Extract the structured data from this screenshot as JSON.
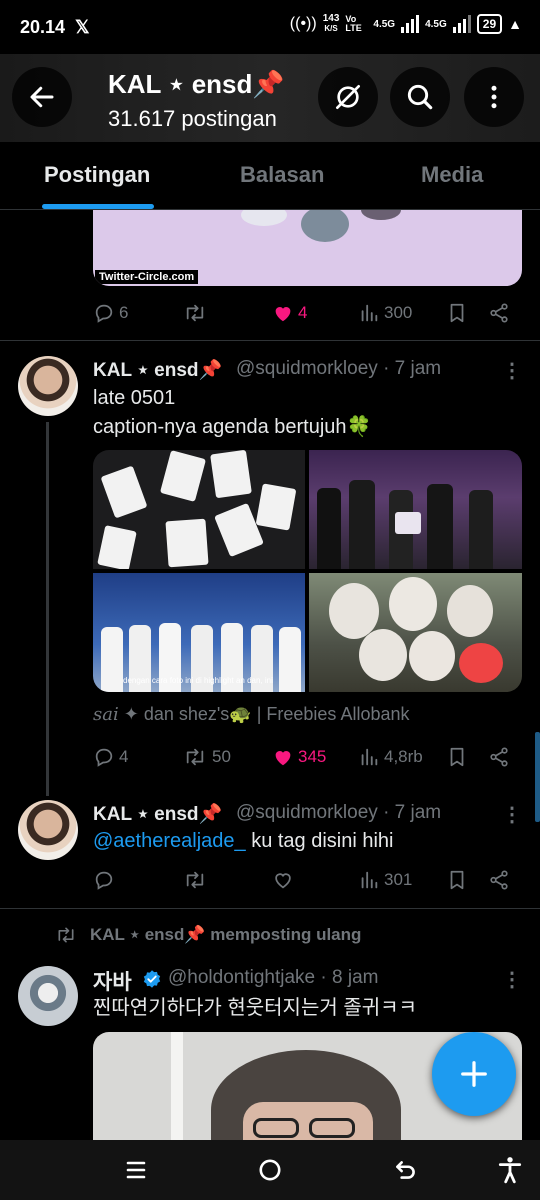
{
  "status_bar": {
    "time": "20.14",
    "app_icon": "x-logo-icon",
    "speed_value": "143",
    "speed_unit": "K/S",
    "volte": "Vo LTE",
    "net1": "4.5G",
    "net2": "4.5G",
    "battery": "29"
  },
  "header": {
    "title": "KAL ⋆ ensd📌",
    "post_count": "31.617 postingan",
    "back_icon": "arrow-left-icon",
    "circle_icon": "circle-slash-icon",
    "search_icon": "search-icon",
    "more_icon": "more-vertical-icon"
  },
  "tabs": [
    {
      "label": "Postingan",
      "active": true
    },
    {
      "label": "Balasan",
      "active": false
    },
    {
      "label": "Media",
      "active": false
    }
  ],
  "tweet0": {
    "card_label": "Twitter-Circle.com",
    "replies": "6",
    "retweets": "",
    "likes": "4",
    "liked": true,
    "views": "300"
  },
  "tweet1": {
    "name": "KAL ⋆ ensd📌",
    "handle": "@squidmorkloey · 7 jam",
    "line1": "late 0501",
    "line2": "caption-nya agenda bertujuh🍀",
    "media_caption": "dengan cara foto ini di highlight an dan, ini",
    "tagged_name": "sai",
    "tagged_rest": " ✦ dan shez's🐢 | Freebies Allobank",
    "replies": "4",
    "retweets": "50",
    "likes": "345",
    "liked": true,
    "views": "4,8rb"
  },
  "tweet2": {
    "name": "KAL ⋆ ensd📌",
    "handle": "@squidmorkloey · 7 jam",
    "mention": "@aetherealjade_",
    "text": " ku tag disini hihi",
    "replies": "",
    "retweets": "",
    "likes": "",
    "liked": false,
    "views": "301"
  },
  "repost": {
    "label": "KAL ⋆ ensd📌 memposting ulang"
  },
  "tweet3": {
    "name": "자바",
    "handle": "@holdontightjake · 8 jam",
    "text": "찐따연기하다가 현웃터지는거 졸귀ㅋㅋ",
    "verified": true
  },
  "colors": {
    "accent": "#1d9bf0",
    "like": "#f91880",
    "muted": "#71767b",
    "background": "#000000"
  },
  "nav": {
    "recents_icon": "menu-lines-icon",
    "home_icon": "circle-home-icon",
    "back_icon": "back-arrow-icon",
    "accessibility_icon": "accessibility-icon"
  }
}
